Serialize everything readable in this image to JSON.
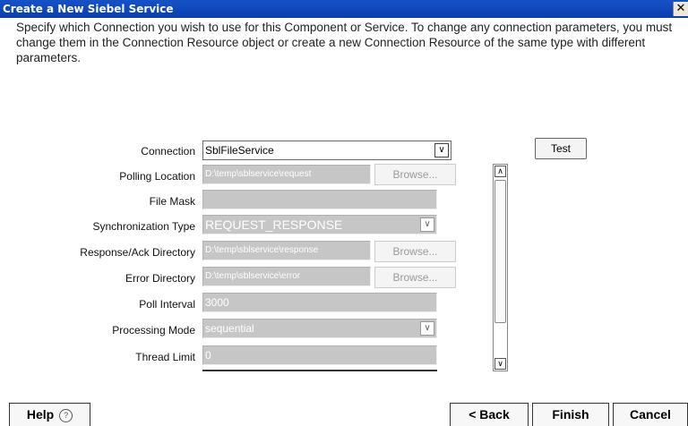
{
  "window": {
    "title": "Create a New Siebel Service",
    "close": "✕"
  },
  "description": "Specify which Connection you wish to use for this Component or Service.  To change any connection parameters, you must change them in the Connection Resource object or create a new Connection Resource of the same type with different parameters.",
  "form": {
    "connection": {
      "label": "Connection",
      "value": "SblFileService"
    },
    "polling_location": {
      "label": "Polling Location",
      "value": "D:\\temp\\sblservice\\request",
      "browse": "Browse..."
    },
    "file_mask": {
      "label": "File Mask",
      "value": ""
    },
    "sync_type": {
      "label": "Synchronization Type",
      "value": "REQUEST_RESPONSE"
    },
    "response_dir": {
      "label": "Response/Ack Directory",
      "value": "D:\\temp\\sblservice\\response",
      "browse": "Browse..."
    },
    "error_dir": {
      "label": "Error Directory",
      "value": "D:\\temp\\sblservice\\error",
      "browse": "Browse..."
    },
    "poll_interval": {
      "label": "Poll Interval",
      "value": "3000"
    },
    "processing_mode": {
      "label": "Processing Mode",
      "value": "sequential"
    },
    "thread_limit": {
      "label": "Thread Limit",
      "value": "0"
    }
  },
  "test_button": "Test",
  "icons": {
    "dropdown": "chevron-down-icon",
    "scroll_up": "chevron-up-icon",
    "scroll_down": "chevron-down-icon",
    "help": "help-circle-icon"
  },
  "buttons": {
    "help": "Help",
    "help_icon": "?",
    "back": "< Back",
    "finish": "Finish",
    "cancel": "Cancel"
  },
  "colors": {
    "titlebar": "#0a3fae",
    "disabled_field": "#c6c6c6"
  }
}
